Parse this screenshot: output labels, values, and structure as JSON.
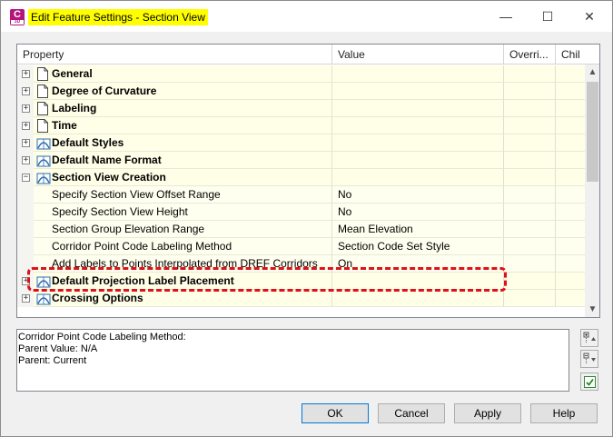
{
  "window": {
    "title": "Edit Feature Settings - Section View",
    "app_icon_letter": "C",
    "app_icon_sub": "3D",
    "minimize": "—",
    "maximize": "☐",
    "close": "✕"
  },
  "grid": {
    "columns": [
      "Property",
      "Value",
      "Overri...",
      "Chil"
    ],
    "rows": [
      {
        "type": "cat",
        "expander": "+",
        "icon": "page-icon",
        "label": "General",
        "value": ""
      },
      {
        "type": "cat",
        "expander": "+",
        "icon": "page-icon",
        "label": "Degree of Curvature",
        "value": ""
      },
      {
        "type": "cat",
        "expander": "+",
        "icon": "page-icon",
        "label": "Labeling",
        "value": ""
      },
      {
        "type": "cat",
        "expander": "+",
        "icon": "page-icon",
        "label": "Time",
        "value": ""
      },
      {
        "type": "cat",
        "expander": "+",
        "icon": "section-view-icon",
        "label": "Default Styles",
        "value": ""
      },
      {
        "type": "cat",
        "expander": "+",
        "icon": "section-view-icon",
        "label": "Default Name Format",
        "value": ""
      },
      {
        "type": "cat",
        "expander": "−",
        "icon": "section-view-icon",
        "label": "Section View Creation",
        "value": ""
      },
      {
        "type": "sub",
        "label": "Specify Section View Offset Range",
        "value": "No"
      },
      {
        "type": "sub",
        "label": "Specify Section View Height",
        "value": "No"
      },
      {
        "type": "sub",
        "label": "Section Group Elevation Range",
        "value": "Mean Elevation"
      },
      {
        "type": "sub",
        "label": "Corridor Point Code Labeling Method",
        "value": "Section Code Set Style"
      },
      {
        "type": "sub",
        "label": "Add Labels to Points Interpolated from DREF Corridors",
        "value": "On"
      },
      {
        "type": "cat",
        "expander": "+",
        "icon": "section-view-icon",
        "label": "Default Projection Label Placement",
        "value": ""
      },
      {
        "type": "cat",
        "expander": "+",
        "icon": "section-view-icon",
        "label": "Crossing Options",
        "value": ""
      }
    ]
  },
  "description": {
    "lines": [
      "Corridor Point Code Labeling Method:",
      "Parent Value: N/A",
      "Parent: Current"
    ]
  },
  "buttons": {
    "ok": "OK",
    "cancel": "Cancel",
    "apply": "Apply",
    "help": "Help"
  },
  "colors": {
    "title_highlight": "#ffff00",
    "annotation_red": "#e0101a",
    "app_icon": "#b4157a"
  }
}
